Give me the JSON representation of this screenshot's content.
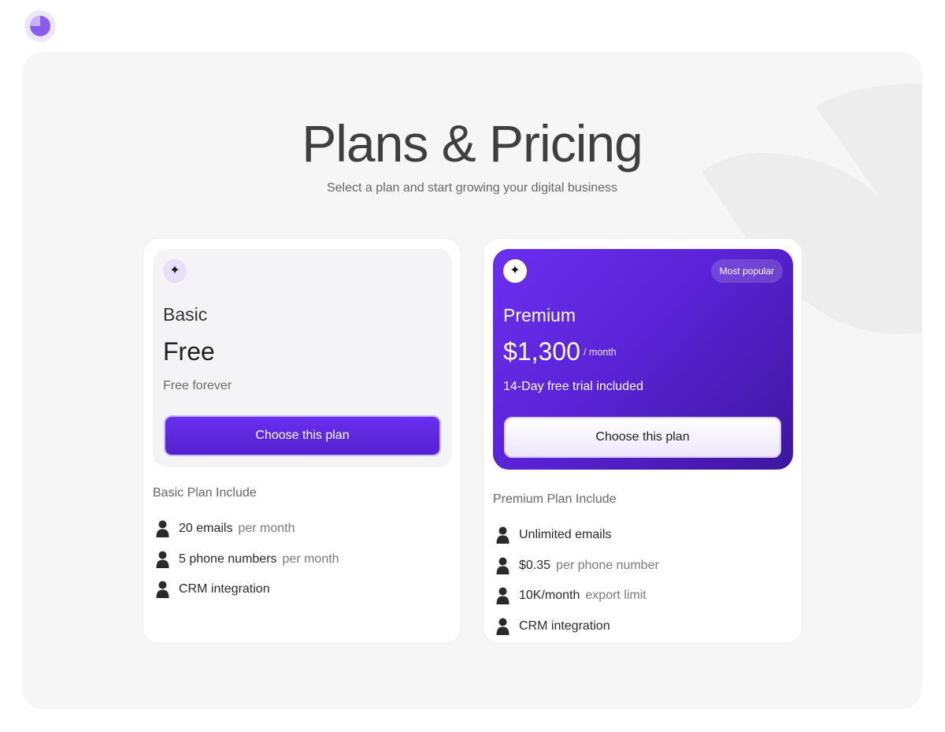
{
  "header": {
    "title": "Plans & Pricing",
    "subtitle": "Select a plan and start growing your digital business"
  },
  "colors": {
    "accent": "#6a2ff0",
    "accent_dark": "#3d169e",
    "panel": "#f6f6f7"
  },
  "plans": [
    {
      "icon": "sparkle-icon",
      "name": "Basic",
      "price": "Free",
      "price_unit": "",
      "note": "Free forever",
      "cta": "Choose this plan",
      "includes_title": "Basic Plan Include",
      "features": [
        {
          "main": "20 emails",
          "sub": "per month"
        },
        {
          "main": "5 phone numbers",
          "sub": "per month"
        },
        {
          "main": "CRM integration",
          "sub": ""
        }
      ]
    },
    {
      "icon": "sparkle-icon",
      "badge": "Most popular",
      "name": "Premium",
      "price": "$1,300",
      "price_unit": "/ month",
      "note": "14-Day free trial included",
      "cta": "Choose this plan",
      "includes_title": "Premium Plan Include",
      "features": [
        {
          "main": "Unlimited emails",
          "sub": ""
        },
        {
          "main": "$0.35",
          "sub": "per phone number"
        },
        {
          "main": "10K/month",
          "sub": "export limit"
        },
        {
          "main": "CRM integration",
          "sub": ""
        }
      ]
    }
  ]
}
